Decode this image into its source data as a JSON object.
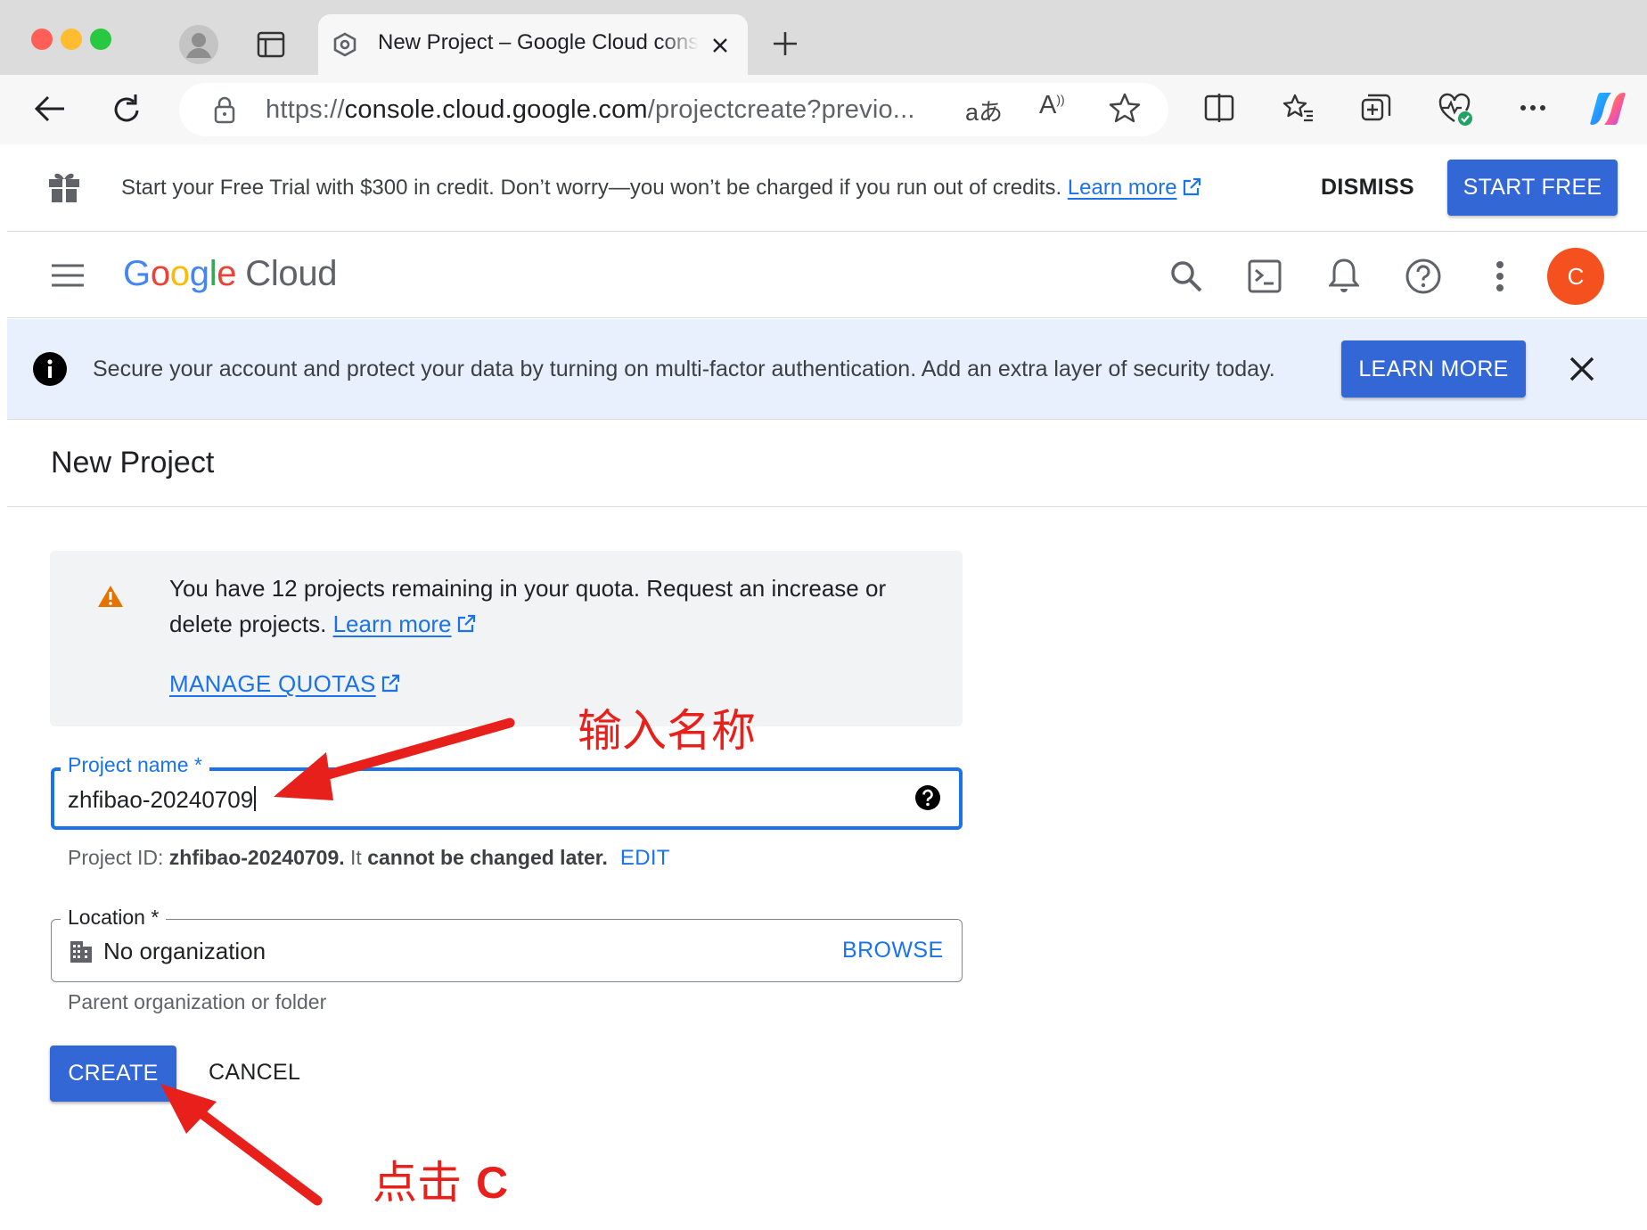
{
  "browser": {
    "tab_title": "New Project – Google Cloud console",
    "url_scheme": "https://",
    "url_host": "console.cloud.google.com",
    "url_path": "/projectcreate?previo..."
  },
  "trial_banner": {
    "text": "Start your Free Trial with $300 in credit. Don’t worry—you won’t be charged if you run out of credits.",
    "link": "Learn more",
    "dismiss": "DISMISS",
    "start_free": "START FREE"
  },
  "header": {
    "logo_letters": [
      "G",
      "o",
      "o",
      "g",
      "l",
      "e"
    ],
    "logo_colors": [
      "#4285F4",
      "#EA4335",
      "#FBBC05",
      "#4285F4",
      "#34A853",
      "#EA4335"
    ],
    "logo_suffix": "Cloud",
    "avatar_initial": "C",
    "avatar_color": "#f4511e"
  },
  "security_banner": {
    "text": "Secure your account and protect your data by turning on multi-factor authentication. Add an extra layer of security today.",
    "learn_more": "LEARN MORE"
  },
  "page": {
    "title": "New Project",
    "quota": {
      "text": "You have 12 projects remaining in your quota. Request an increase or delete projects.",
      "link": "Learn more",
      "manage": "MANAGE QUOTAS"
    },
    "project_name": {
      "label": "Project name *",
      "value": "zhfibao-20240709"
    },
    "project_id": {
      "prefix": "Project ID:",
      "id": "zhfibao-20240709.",
      "it": "It",
      "note": "cannot be changed later.",
      "edit": "EDIT"
    },
    "location": {
      "label": "Location *",
      "value": "No organization",
      "browse": "BROWSE",
      "hint": "Parent organization or folder"
    },
    "buttons": {
      "create": "CREATE",
      "cancel": "CANCEL"
    }
  },
  "annotations": {
    "name_hint": "输入名称",
    "click_hint": "点击",
    "click_target": "C"
  },
  "colors": {
    "accent": "#1a73e8",
    "button": "#3367d6",
    "annotation": "#e8201b",
    "warning": "#e37400"
  }
}
